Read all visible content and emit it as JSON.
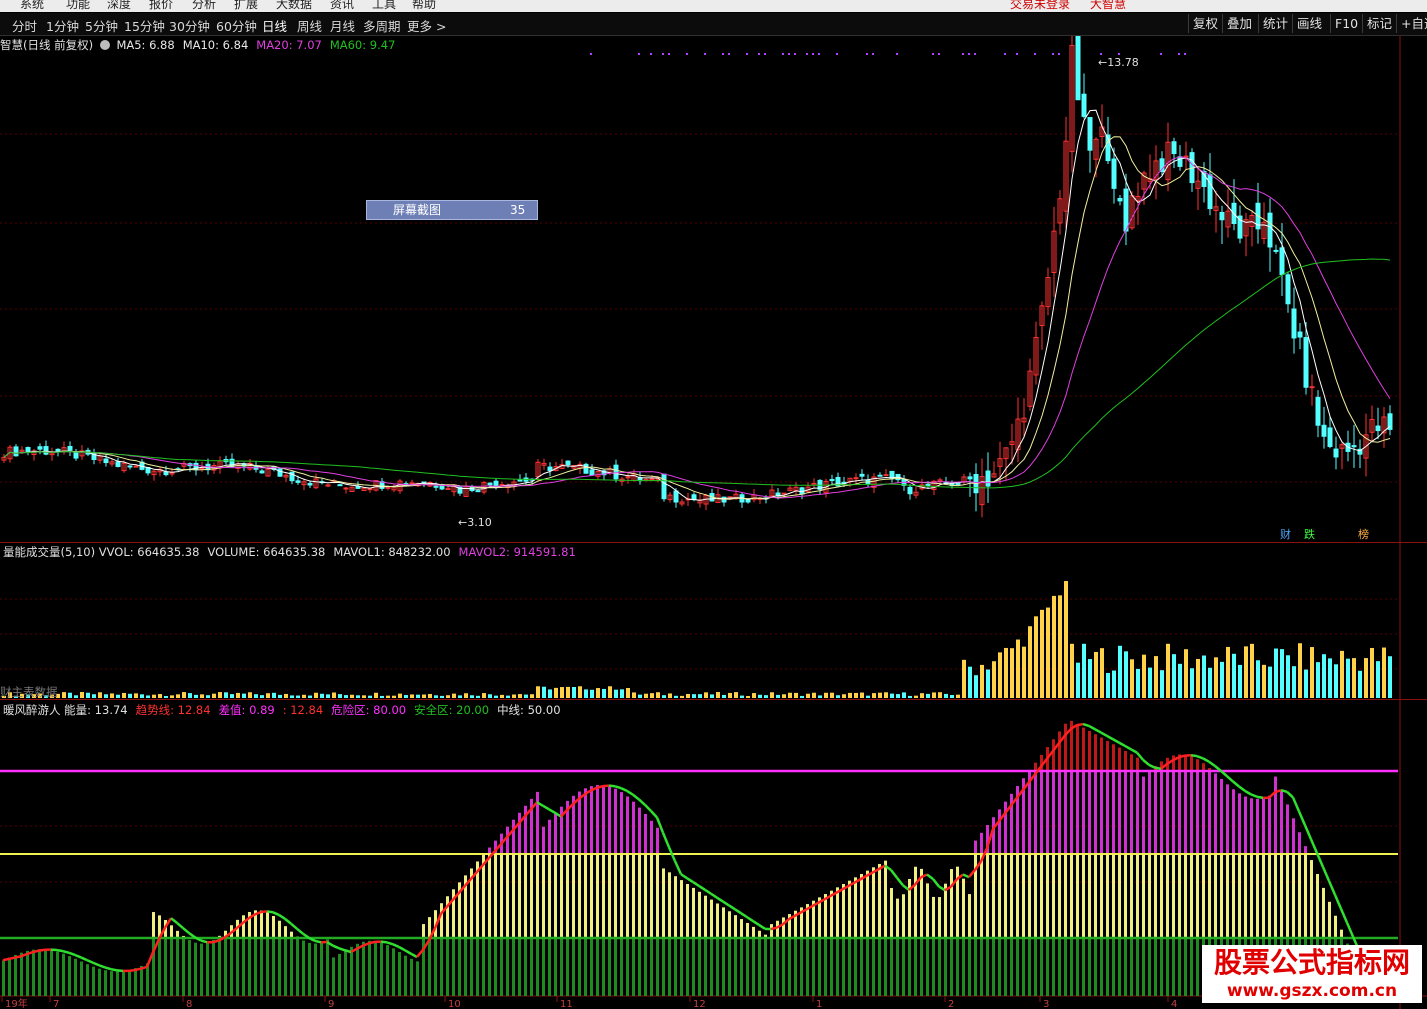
{
  "app": {
    "menu": [
      "系统",
      "功能",
      "深度",
      "报价",
      "分析",
      "扩展",
      "大数据",
      "资讯",
      "工具",
      "帮助"
    ],
    "notice": [
      "交易未登录",
      "大智慧"
    ]
  },
  "toolbar": {
    "periods": [
      "分时",
      "1分钟",
      "5分钟",
      "15分钟",
      "30分钟",
      "60分钟",
      "日线",
      "周线",
      "月线",
      "多周期",
      "更多 >"
    ],
    "active_period": "日线",
    "right": [
      "复权",
      "叠加",
      "统计",
      "画线",
      "F10",
      "标记",
      "+自选"
    ]
  },
  "main_panel": {
    "title": "智慧(日线 前复权)",
    "indicators": [
      {
        "label": "MA5: 6.88",
        "color": "#e8e8e8"
      },
      {
        "label": "MA10: 6.84",
        "color": "#e8e8e8"
      },
      {
        "label": "MA20: 7.07",
        "color": "#e040e0"
      },
      {
        "label": "MA60: 9.47",
        "color": "#20c020"
      }
    ],
    "high_label": "13.78",
    "low_label": "3.10",
    "event_markers": [
      {
        "text": "财",
        "color": "#50a8ff"
      },
      {
        "text": "跌",
        "color": "#40ff40"
      },
      {
        "text": "榜",
        "color": "#ffb040"
      }
    ]
  },
  "snapshot_tip": {
    "label": "屏幕截图",
    "value": "35"
  },
  "volume_panel": {
    "title": "量能成交量(5,10)",
    "items": [
      {
        "label": "VVOL: 664635.38",
        "color": "#e0e0e0"
      },
      {
        "label": "VOLUME: 664635.38",
        "color": "#e0e0e0"
      },
      {
        "label": "MAVOL1: 848232.00",
        "color": "#e0e0e0"
      },
      {
        "label": "MAVOL2: 914591.81",
        "color": "#e040e0"
      }
    ],
    "overlay_text": "财主表数据"
  },
  "osc_panel": {
    "title": "暖风醉游人",
    "items": [
      {
        "label": "能量: 13.74",
        "color": "#e0e0e0"
      },
      {
        "label": "趋势线: 12.84",
        "color": "#ff3030"
      },
      {
        "label": "差值: 0.89",
        "color": "#ff30ff"
      },
      {
        "label": ": 12.84",
        "color": "#ff3030"
      },
      {
        "label": "危险区: 80.00",
        "color": "#ff30ff"
      },
      {
        "label": "安全区: 20.00",
        "color": "#20c020"
      },
      {
        "label": "中线: 50.00",
        "color": "#e0e0e0"
      }
    ]
  },
  "time_axis": [
    "19年",
    "7",
    "8",
    "9",
    "10",
    "11",
    "12",
    "1",
    "2",
    "3",
    "4"
  ],
  "watermark": {
    "line1": "股票公式指标网",
    "line2": "www.gszx.com.cn"
  },
  "colors": {
    "up": "#ff3232",
    "down": "#54ffff",
    "ma5": "#ffffff",
    "ma10": "#f0f0a0",
    "ma20": "#e040e0",
    "ma60": "#20c020",
    "danger": "#ff30ff",
    "safe": "#20c020",
    "mid": "#f0f050"
  }
}
